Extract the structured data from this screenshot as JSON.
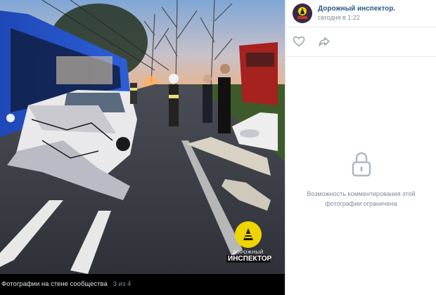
{
  "viewer": {
    "footer_label": "Фотографии на стене сообщества",
    "counter": "3 из 4",
    "watermark": {
      "line1": "ДОРОЖНЫЙ",
      "line2": "ИНСПЕКТОР",
      "color": "#f0d400"
    },
    "photo_alt": "Car accident scene at dusk with trolleybus, damaged white car and firefighters"
  },
  "post": {
    "author_name": "Дорожный инспектор.",
    "timestamp": "сегодня в 1:22",
    "avatar_icon": "road-inspector-logo"
  },
  "actions": {
    "like_icon": "heart-icon",
    "share_icon": "share-icon"
  },
  "comments": {
    "restricted_icon": "lock-icon",
    "restricted_text": "Возможность комментирования этой фотографии ограничена"
  },
  "colors": {
    "link": "#2a5885",
    "muted": "#818c99",
    "icon": "#99a2ad"
  }
}
